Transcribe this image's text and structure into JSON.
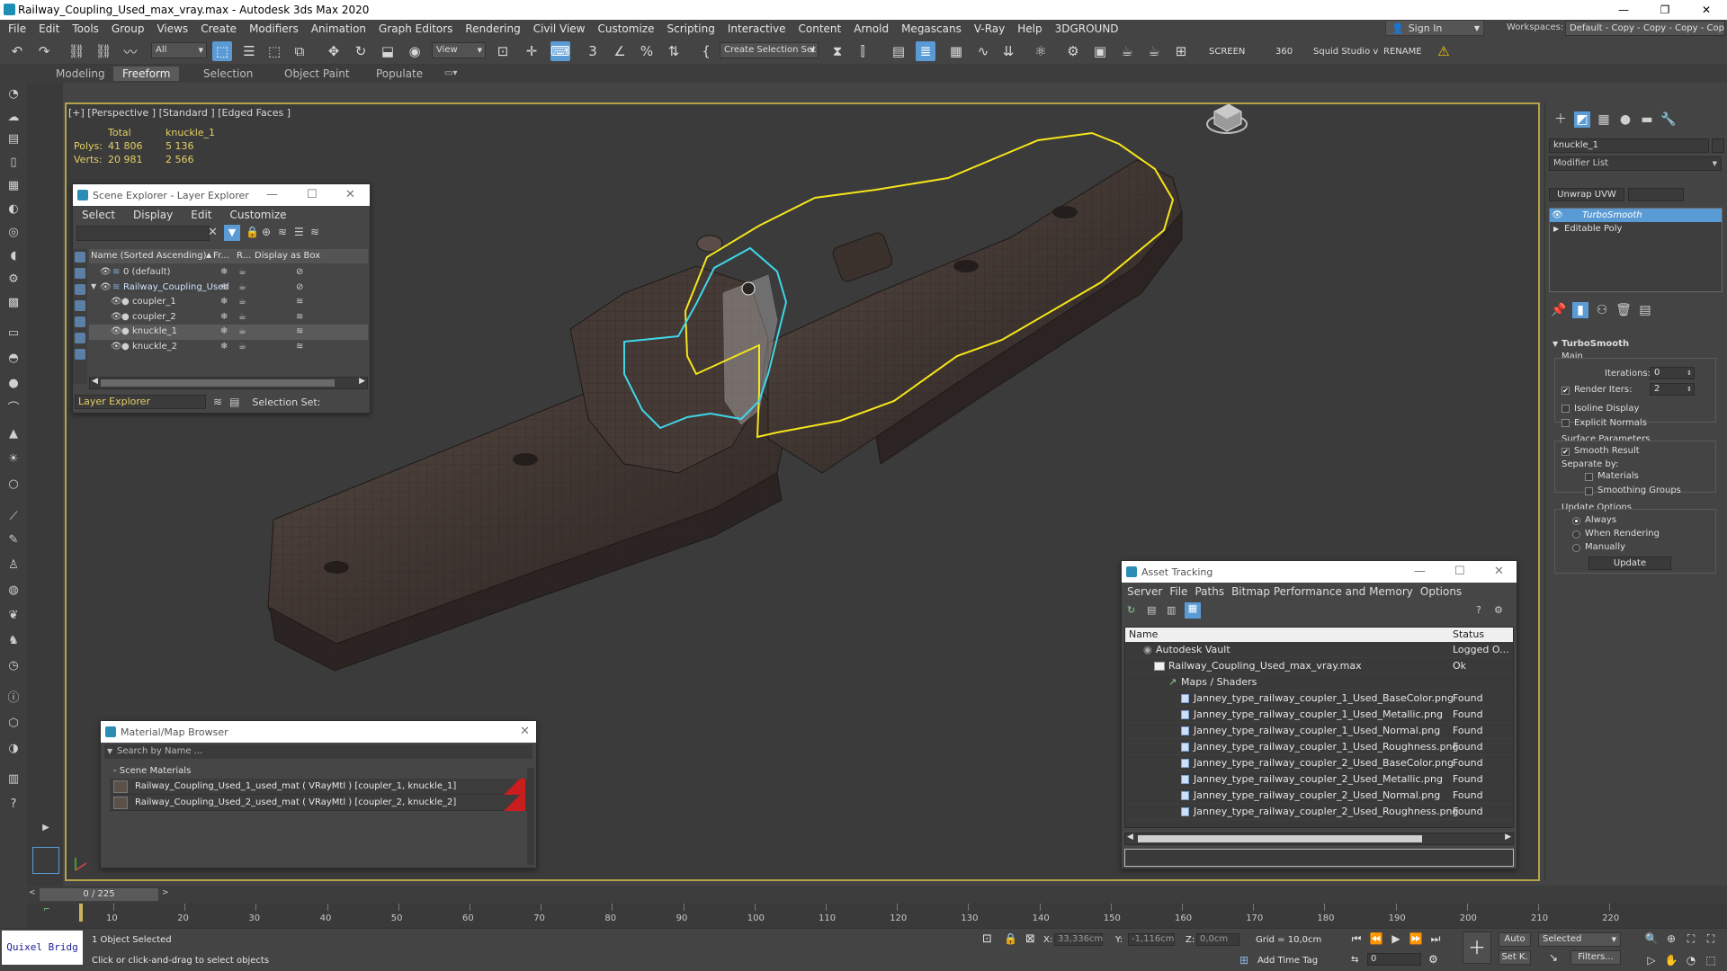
{
  "app": {
    "title": "Railway_Coupling_Used_max_vray.max - Autodesk 3ds Max 2020",
    "window_controls": [
      "—",
      "❐",
      "✕"
    ]
  },
  "menu": [
    "File",
    "Edit",
    "Tools",
    "Group",
    "Views",
    "Create",
    "Modifiers",
    "Animation",
    "Graph Editors",
    "Rendering",
    "Civil View",
    "Customize",
    "Scripting",
    "Interactive",
    "Content",
    "Arnold",
    "Megascans",
    "V-Ray",
    "Help",
    "3DGROUND"
  ],
  "account": {
    "sign_in": "Sign In",
    "workspaces_label": "Workspaces:",
    "workspace_value": "Default - Copy - Copy - Copy - Copy"
  },
  "toolbar": {
    "selection_filter": "All",
    "ref_coord": "View",
    "named_selection": "Create Selection Set",
    "screen_label": "SCREEN",
    "value_360": "360",
    "studio_label": "Squid Studio v",
    "rename_label": "RENAME"
  },
  "ribbon_tabs": [
    "Modeling",
    "Freeform",
    "Selection",
    "Object Paint",
    "Populate"
  ],
  "ribbon_active": "Freeform",
  "viewport": {
    "label": "[+] [Perspective ] [Standard ] [Edged Faces ]",
    "stats": {
      "col_total": "Total",
      "col_object": "knuckle_1",
      "polys_label": "Polys:",
      "polys_total": "41 806",
      "polys_object": "5 136",
      "verts_label": "Verts:",
      "verts_total": "20 981",
      "verts_object": "2 566"
    }
  },
  "scene_explorer": {
    "title": "Scene Explorer - Layer Explorer",
    "menu": [
      "Select",
      "Display",
      "Edit",
      "Customize"
    ],
    "columns": {
      "name": "Name (Sorted Ascending)",
      "freeze": "Fr...",
      "render": "R...",
      "box": "Display as Box"
    },
    "rows": [
      {
        "name": "0 (default)",
        "indent": 0
      },
      {
        "name": "Railway_Coupling_Used",
        "indent": 0
      },
      {
        "name": "coupler_1",
        "indent": 1
      },
      {
        "name": "coupler_2",
        "indent": 1
      },
      {
        "name": "knuckle_1",
        "indent": 1
      },
      {
        "name": "knuckle_2",
        "indent": 1
      }
    ],
    "explorer_dropdown": "Layer Explorer",
    "selection_set_label": "Selection Set:"
  },
  "material_browser": {
    "title": "Material/Map Browser",
    "search_placeholder": "Search by Name ...",
    "section": "- Scene Materials",
    "materials": [
      "Railway_Coupling_Used_1_used_mat  ( VRayMtl )  [coupler_1, knuckle_1]",
      "Railway_Coupling_Used_2_used_mat  ( VRayMtl )  [coupler_2, knuckle_2]"
    ]
  },
  "asset_tracking": {
    "title": "Asset Tracking",
    "menu": [
      "Server",
      "File",
      "Paths",
      "Bitmap Performance and Memory",
      "Options"
    ],
    "columns": {
      "name": "Name",
      "status": "Status"
    },
    "rows": [
      {
        "name": "Autodesk Vault",
        "status": "Logged O...",
        "level": 0
      },
      {
        "name": "Railway_Coupling_Used_max_vray.max",
        "status": "Ok",
        "level": 1
      },
      {
        "name": "Maps / Shaders",
        "status": "",
        "level": 2
      },
      {
        "name": "Janney_type_railway_coupler_1_Used_BaseColor.png",
        "status": "Found",
        "level": 3
      },
      {
        "name": "Janney_type_railway_coupler_1_Used_Metallic.png",
        "status": "Found",
        "level": 3
      },
      {
        "name": "Janney_type_railway_coupler_1_Used_Normal.png",
        "status": "Found",
        "level": 3
      },
      {
        "name": "Janney_type_railway_coupler_1_Used_Roughness.png",
        "status": "Found",
        "level": 3
      },
      {
        "name": "Janney_type_railway_coupler_2_Used_BaseColor.png",
        "status": "Found",
        "level": 3
      },
      {
        "name": "Janney_type_railway_coupler_2_Used_Metallic.png",
        "status": "Found",
        "level": 3
      },
      {
        "name": "Janney_type_railway_coupler_2_Used_Normal.png",
        "status": "Found",
        "level": 3
      },
      {
        "name": "Janney_type_railway_coupler_2_Used_Roughness.png",
        "status": "Found",
        "level": 3
      }
    ]
  },
  "command_panel": {
    "object_name": "knuckle_1",
    "modifier_list": "Modifier List",
    "unwrap_button": "Unwrap UVW",
    "stack": [
      "TurboSmooth",
      "Editable Poly"
    ],
    "turbosmooth": {
      "title": "TurboSmooth",
      "main": "Main",
      "iterations_label": "Iterations:",
      "iterations_value": "0",
      "render_iters_label": "Render Iters:",
      "render_iters_value": "2",
      "isoline": "Isoline Display",
      "explicit_normals": "Explicit Normals",
      "surface_params": "Surface Parameters",
      "smooth_result": "Smooth Result",
      "separate_by": "Separate by:",
      "materials": "Materials",
      "smoothing_groups": "Smoothing Groups",
      "update_options": "Update Options",
      "always": "Always",
      "when_rendering": "When Rendering",
      "manually": "Manually",
      "update_button": "Update"
    }
  },
  "timeline": {
    "frame_display": "0 / 225",
    "ticks": [
      "10",
      "20",
      "30",
      "40",
      "50",
      "60",
      "70",
      "80",
      "90",
      "100",
      "110",
      "120",
      "130",
      "140",
      "150",
      "160",
      "170",
      "180",
      "190",
      "200",
      "210",
      "220"
    ]
  },
  "status": {
    "quixel": "Quixel Bridg",
    "selected": "1 Object Selected",
    "prompt": "Click or click-and-drag to select objects",
    "x_label": "X:",
    "x_value": "33,336cm",
    "y_label": "Y:",
    "y_value": "-1,116cm",
    "z_label": "Z:",
    "z_value": "0,0cm",
    "grid": "Grid = 10,0cm",
    "add_time_tag": "Add Time Tag",
    "auto": "Auto",
    "set_key": "Set K.",
    "selected_dropdown": "Selected",
    "filters": "Filters...",
    "frame_value": "0"
  },
  "colors": {
    "accent": "#5b9bd5",
    "viewport_border": "#b5a24a",
    "stats_text": "#e3cf63",
    "selection_yellow": "#f5e51b",
    "selection_cyan": "#3fd6e8"
  }
}
